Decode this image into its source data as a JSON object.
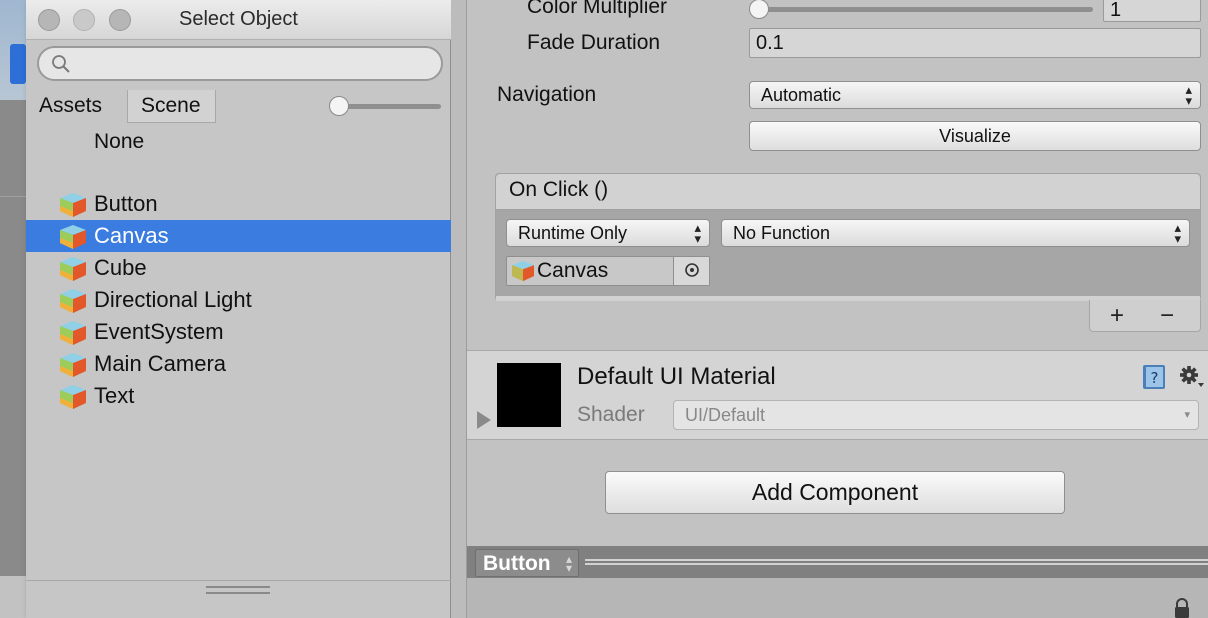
{
  "select_window": {
    "title": "Select Object",
    "search": {
      "value": "",
      "placeholder": ""
    },
    "tabs": [
      {
        "label": "Assets"
      },
      {
        "label": "Scene"
      }
    ],
    "none_label": "None",
    "objects": [
      {
        "label": "Button",
        "selected": false
      },
      {
        "label": "Canvas",
        "selected": true
      },
      {
        "label": "Cube",
        "selected": false
      },
      {
        "label": "Directional Light",
        "selected": false
      },
      {
        "label": "EventSystem",
        "selected": false
      },
      {
        "label": "Main Camera",
        "selected": false
      },
      {
        "label": "Text",
        "selected": false
      }
    ],
    "zoom_level": 0
  },
  "inspector": {
    "color_multiplier": {
      "label": "Color Multiplier",
      "value": "1",
      "slider_fraction": 0
    },
    "fade_duration": {
      "label": "Fade Duration",
      "value": "0.1"
    },
    "navigation": {
      "label": "Navigation",
      "value": "Automatic",
      "visualize_label": "Visualize"
    },
    "on_click": {
      "header": "On Click ()",
      "mode": "Runtime Only",
      "function": "No Function",
      "target_object": "Canvas",
      "plus": "+",
      "minus": "−"
    },
    "material": {
      "name": "Default UI Material",
      "shader_label": "Shader",
      "shader_value": "UI/Default"
    },
    "add_component_label": "Add Component",
    "status": {
      "label": "Button"
    }
  },
  "colors": {
    "selection": "#3b7ce0",
    "panel": "#c2c2c2"
  }
}
